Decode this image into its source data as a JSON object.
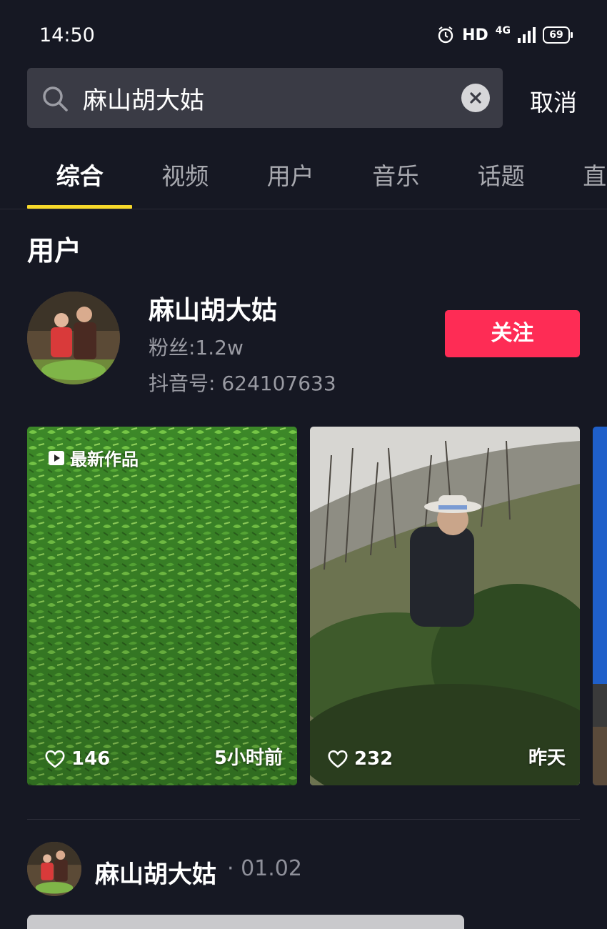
{
  "status_bar": {
    "time": "14:50",
    "hd": "HD",
    "network": "4G",
    "battery": "69"
  },
  "search": {
    "query": "麻山胡大姑",
    "cancel_label": "取消"
  },
  "tabs": [
    {
      "label": "综合",
      "active": true
    },
    {
      "label": "视频",
      "active": false
    },
    {
      "label": "用户",
      "active": false
    },
    {
      "label": "音乐",
      "active": false
    },
    {
      "label": "话题",
      "active": false
    },
    {
      "label": "直播",
      "active": false
    }
  ],
  "section": {
    "title": "用户"
  },
  "user": {
    "name": "麻山胡大姑",
    "fans": "粉丝:1.2w",
    "douyin_id": "抖音号: 624107633",
    "follow_label": "关注"
  },
  "videos": [
    {
      "badge": "最新作品",
      "likes": "146",
      "time": "5小时前"
    },
    {
      "likes": "232",
      "time": "昨天"
    }
  ],
  "post": {
    "author": "麻山胡大姑",
    "date": "· 01.02"
  },
  "colors": {
    "background": "#161823",
    "accent_follow": "#fe2c55",
    "tab_indicator": "#f7d92a"
  },
  "icons": [
    "alarm-icon",
    "search-icon",
    "clear-icon",
    "play-badge-icon",
    "heart-icon"
  ]
}
